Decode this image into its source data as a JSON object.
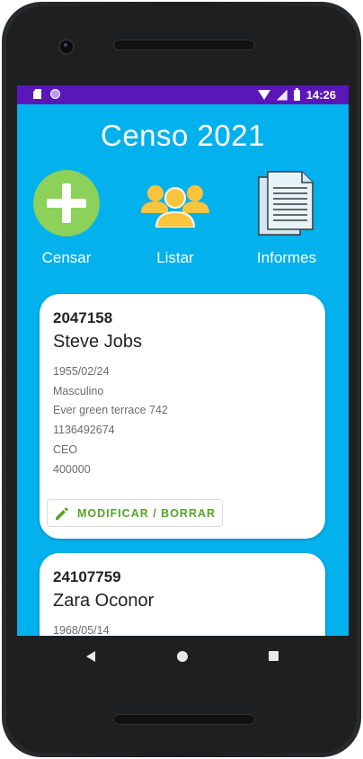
{
  "status_bar": {
    "time": "14:26"
  },
  "app": {
    "title": "Censo 2021"
  },
  "actions": [
    {
      "label": "Censar",
      "icon": "plus-circle-icon"
    },
    {
      "label": "Listar",
      "icon": "users-icon"
    },
    {
      "label": "Informes",
      "icon": "document-icon"
    }
  ],
  "records": [
    {
      "id": "2047158",
      "name": "Steve Jobs",
      "birthdate": "1955/02/24",
      "gender": "Masculino",
      "address": "Ever green terrace 742",
      "phone": "1136492674",
      "occupation": "CEO",
      "income": "400000",
      "button_label": "MODIFICAR / BORRAR"
    },
    {
      "id": "24107759",
      "name": "Zara Oconor",
      "birthdate": "1968/05/14"
    }
  ],
  "colors": {
    "background": "#03b1ec",
    "status_bar": "#5a16b8",
    "accent_green": "#57a32c",
    "plus_green": "#8bd15a",
    "users_yellow": "#fcc43c"
  }
}
